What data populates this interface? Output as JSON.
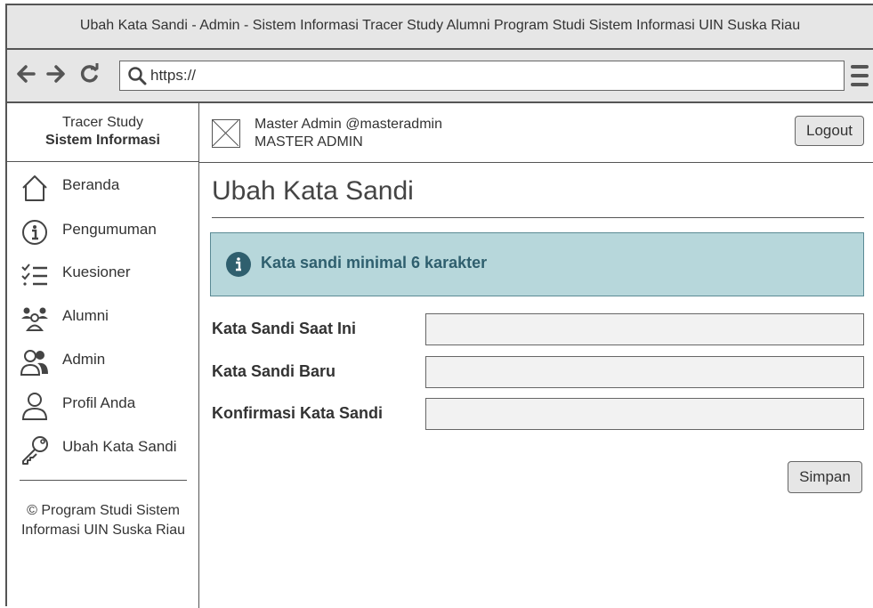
{
  "window": {
    "title": "Ubah Kata Sandi - Admin - Sistem Informasi Tracer Study Alumni Program Studi Sistem Informasi UIN Suska Riau"
  },
  "browser": {
    "url": "https://",
    "back_icon": "arrow-left-icon",
    "forward_icon": "arrow-right-icon",
    "reload_icon": "reload-icon",
    "search_icon": "search-icon",
    "menu_icon": "hamburger-menu-icon"
  },
  "brand": {
    "line1": "Tracer Study",
    "line2": "Sistem Informasi"
  },
  "sidebar": {
    "items": [
      {
        "label": "Beranda",
        "icon": "home-icon"
      },
      {
        "label": "Pengumuman",
        "icon": "info-icon"
      },
      {
        "label": "Kuesioner",
        "icon": "checklist-icon"
      },
      {
        "label": "Alumni",
        "icon": "group-icon"
      },
      {
        "label": "Admin",
        "icon": "users-icon"
      },
      {
        "label": "Profil Anda",
        "icon": "user-icon"
      },
      {
        "label": "Ubah Kata Sandi",
        "icon": "key-icon"
      }
    ],
    "copyright": "© Program Studi Sistem Informasi UIN Suska Riau"
  },
  "user": {
    "name": "Master Admin @masteradmin",
    "role": "MASTER ADMIN",
    "logout_label": "Logout"
  },
  "page": {
    "title": "Ubah Kata Sandi"
  },
  "alert": {
    "message": "Kata sandi minimal 6 karakter",
    "bg_color": "#b7d7db",
    "text_color": "#2f5f6e"
  },
  "form": {
    "current_password_label": "Kata Sandi Saat Ini",
    "new_password_label": "Kata Sandi Baru",
    "confirm_password_label": "Konfirmasi Kata Sandi",
    "submit_label": "Simpan"
  }
}
